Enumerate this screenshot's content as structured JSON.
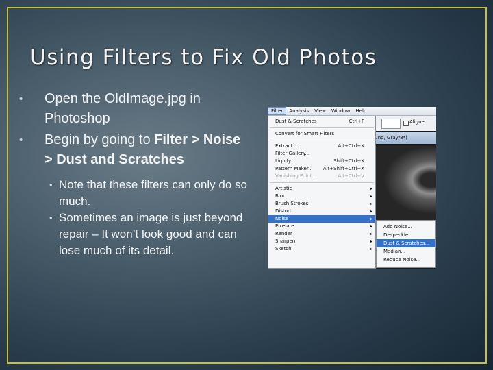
{
  "slide": {
    "title": "Using Filters to Fix Old Photos",
    "bullets": [
      {
        "text": "Open the OldImage.jpg in Photoshop"
      },
      {
        "prefix": "Begin by going to ",
        "bold": "Filter > Noise > Dust and Scratches"
      }
    ],
    "sub_bullets": [
      "Note that these filters can only do so much.",
      "Sometimes an image is just beyond repair – It won’t look good and can lose much of its detail."
    ],
    "bullet_glyph": "•"
  },
  "screenshot": {
    "menubar": [
      "Filter",
      "Analysis",
      "View",
      "Window",
      "Help"
    ],
    "options": {
      "aligned_label": "Aligned"
    },
    "doc_tab": "ound, Gray/8*)",
    "filter_menu": {
      "top": [
        {
          "label": "Dust & Scratches",
          "shortcut": "Ctrl+F"
        }
      ],
      "convert": {
        "label": "Convert for Smart Filters"
      },
      "special": [
        {
          "label": "Extract...",
          "shortcut": "Alt+Ctrl+X"
        },
        {
          "label": "Filter Gallery..."
        },
        {
          "label": "Liquify...",
          "shortcut": "Shift+Ctrl+X"
        },
        {
          "label": "Pattern Maker...",
          "shortcut": "Alt+Shift+Ctrl+X"
        },
        {
          "label": "Vanishing Point...",
          "shortcut": "Alt+Ctrl+V"
        }
      ],
      "categories": [
        "Artistic",
        "Blur",
        "Brush Strokes",
        "Distort",
        "Noise",
        "Pixelate",
        "Render",
        "Sharpen",
        "Sketch"
      ],
      "arrow": "▸"
    },
    "noise_submenu": [
      "Add Noise...",
      "Despeckle",
      "Dust & Scratches...",
      "Median...",
      "Reduce Noise..."
    ]
  }
}
